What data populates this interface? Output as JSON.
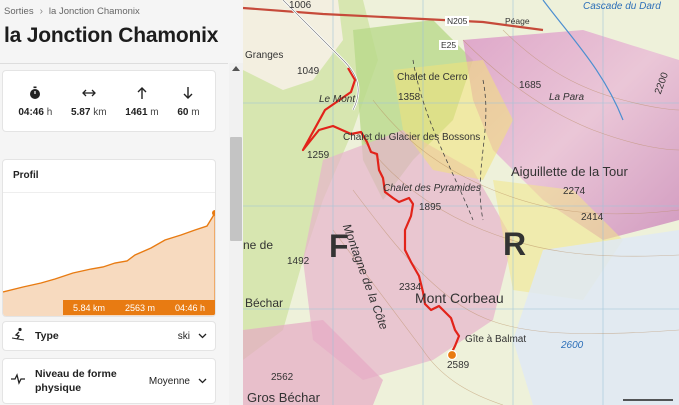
{
  "breadcrumb": {
    "parent": "Sorties",
    "current": "la Jonction Chamonix"
  },
  "title": "la Jonction Chamonix",
  "stats": [
    {
      "icon": "stopwatch-icon",
      "value": "04:46",
      "unit": "h"
    },
    {
      "icon": "horizontal-arrows-icon",
      "value": "5.87",
      "unit": "km"
    },
    {
      "icon": "arrow-up-icon",
      "value": "1461",
      "unit": "m"
    },
    {
      "icon": "arrow-down-icon",
      "value": "60",
      "unit": "m"
    }
  ],
  "profile": {
    "heading": "Profil",
    "distance": "5.84 km",
    "altitude": "2563 m",
    "time": "04:46 h"
  },
  "type": {
    "label": "Type",
    "value": "ski"
  },
  "niveau": {
    "label": "Niveau de forme physique",
    "value": "Moyenne"
  },
  "map": {
    "labels": {
      "n_1006": "1006",
      "cascade": "Cascade du Dard",
      "n205": "N205",
      "peage": "Péage",
      "granges": "Granges",
      "e25": "E25",
      "n_1049": "1049",
      "chalet_cerro": "Chalet de Cerro",
      "n_1358": "1358",
      "n_1685": "1685",
      "la_para": "La Para",
      "le_mont": "Le Mont",
      "chalet_glacier": "Chalet du Glacier des Bossons",
      "n_1259": "1259",
      "aiguillette": "Aiguillette de la Tour",
      "chalet_pyramides": "Chalet des Pyramides",
      "n_2274": "2274",
      "n_1895": "1895",
      "n_2414": "2414",
      "letter_f": "F",
      "letter_r": "R",
      "n_1492": "1492",
      "montagne": "Montagne de la Côte",
      "ne_de": "ne de",
      "n_2334": "2334",
      "mont_corbeau": "Mont Corbeau",
      "bechar": "Béchar",
      "gite": "Gîte à Balmat",
      "n_2589": "2589",
      "n_2600": "2600",
      "n_2562": "2562",
      "gros_bechar": "Gros Béchar",
      "n_2200": "2200"
    }
  }
}
